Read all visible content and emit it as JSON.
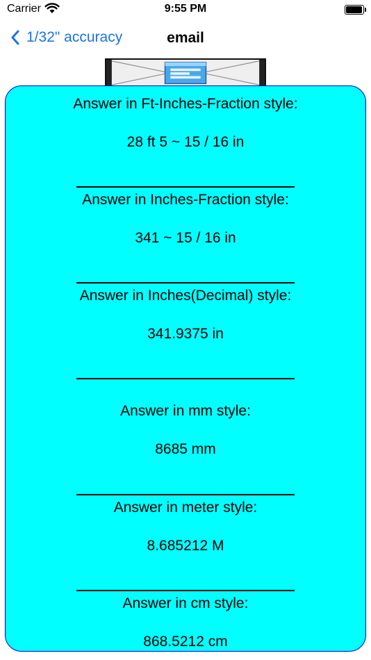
{
  "status_bar": {
    "carrier": "Carrier",
    "time": "9:55 PM"
  },
  "nav": {
    "back_label": "1/32\" accuracy",
    "title": "email"
  },
  "email_button": {
    "icon": "envelope-e-icon",
    "letter": "E"
  },
  "results": {
    "ft_in_frac": {
      "label": "Answer in Ft-Inches-Fraction style:",
      "value": "28 ft 5 ~ 15 / 16 in"
    },
    "in_frac": {
      "label": "Answer in Inches-Fraction style:",
      "value": "341 ~ 15 / 16 in"
    },
    "in_decimal": {
      "label": "Answer in Inches(Decimal) style:",
      "value": "341.9375 in"
    },
    "mm": {
      "label": "Answer in mm style:",
      "value": "8685 mm"
    },
    "meter": {
      "label": "Answer in meter style:",
      "value": "8.685212 M"
    },
    "cm": {
      "label": "Answer in cm style:",
      "value": "868.5212 cm"
    }
  },
  "colors": {
    "card_background": "#00ffff",
    "card_border": "#0000dd",
    "accent": "#1a73e8"
  }
}
